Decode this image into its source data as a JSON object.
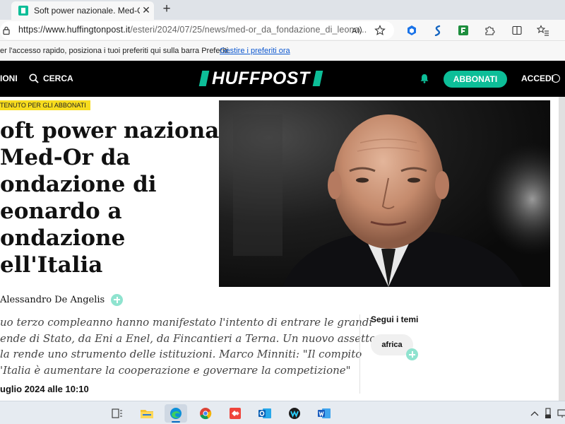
{
  "browser": {
    "tab_title": "Soft power nazionale. Med-Or da",
    "tab_close": "✕",
    "new_tab": "+",
    "url_host": "https://www.huffingtonpost.it",
    "url_path": "/esteri/2024/07/25/news/med-or_da_fondazione_di_leona...",
    "favorites_message": "er l'accesso rapido, posiziona i tuoi preferiti qui sulla barra Preferiti.",
    "favorites_link": "Gestire i preferiti ora"
  },
  "header": {
    "sections_label": "IONI",
    "search_label": "CERCA",
    "logo_text": "HUFFPOST",
    "subscribe_label": "ABBONATI",
    "login_label": "ACCEDI",
    "accent_color": "#0dbe98"
  },
  "article": {
    "badge": "TENUTO PER GLI ABBONATI",
    "headline": "oft power nazionale.\nMed-Or da\nondazione di\neonardo a\nondazione\nell'Italia",
    "author": "Alessandro De Angelis",
    "summary": "uo terzo compleanno hanno manifestato l'intento di entrare le grandi\nende di Stato, da Eni a Enel, da Fincantieri a Terna. Un nuovo assetto\nla rende uno strumento delle istituzioni. Marco Minniti: \"Il compito\n'Italia è aumentare la cooperazione e governare la competizione\"",
    "date": "uglio 2024 alle 10:10"
  },
  "topics": {
    "title": "Segui i temi",
    "items": [
      "africa"
    ]
  },
  "taskbar": {
    "apps": [
      "task-view-icon",
      "file-explorer-icon",
      "edge-icon",
      "chrome-icon",
      "anydesk-icon",
      "outlook-icon",
      "webex-icon",
      "word-icon"
    ]
  }
}
